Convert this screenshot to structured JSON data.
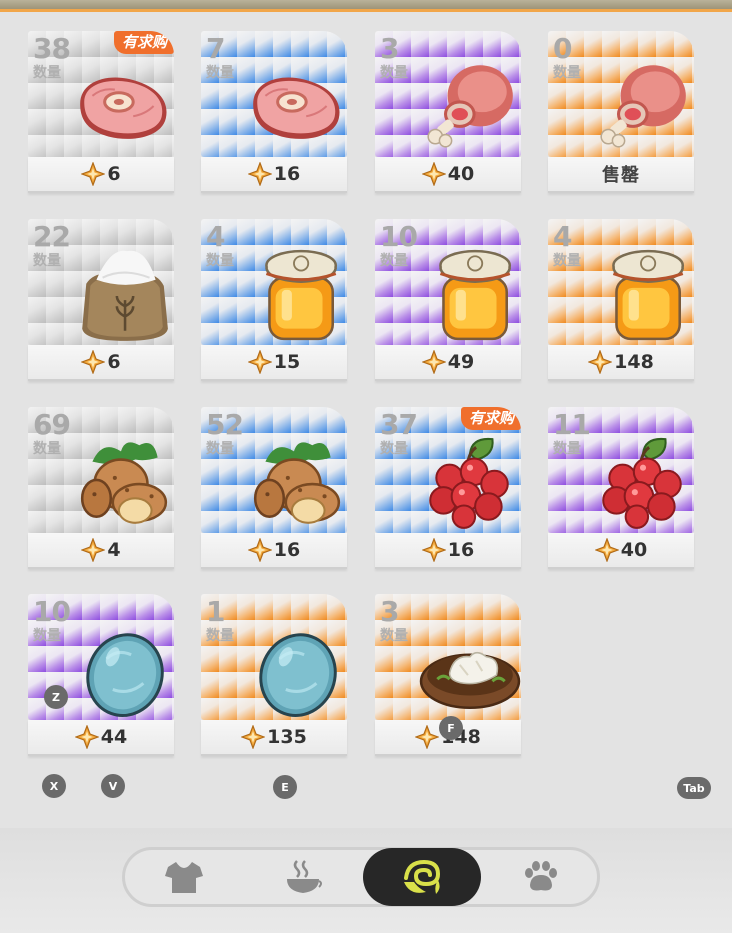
{
  "labels": {
    "quantity": "数量",
    "sold_out": "售罄",
    "wanted_badge": "有求购"
  },
  "items": [
    {
      "count": "38",
      "price": "6",
      "rarity": "grey",
      "icon": "steak-icon",
      "wanted": true,
      "sold_out": false
    },
    {
      "count": "7",
      "price": "16",
      "rarity": "blue",
      "icon": "steak-icon",
      "wanted": false,
      "sold_out": false
    },
    {
      "count": "3",
      "price": "40",
      "rarity": "purple",
      "icon": "ham-leg-icon",
      "wanted": false,
      "sold_out": false
    },
    {
      "count": "0",
      "price": "",
      "rarity": "orange",
      "icon": "ham-leg-icon",
      "wanted": false,
      "sold_out": true
    },
    {
      "count": "22",
      "price": "6",
      "rarity": "grey",
      "icon": "flour-sack-icon",
      "wanted": false,
      "sold_out": false
    },
    {
      "count": "4",
      "price": "15",
      "rarity": "blue",
      "icon": "honey-jar-icon",
      "wanted": false,
      "sold_out": false
    },
    {
      "count": "10",
      "price": "49",
      "rarity": "purple",
      "icon": "honey-jar-icon",
      "wanted": false,
      "sold_out": false
    },
    {
      "count": "4",
      "price": "148",
      "rarity": "orange",
      "icon": "honey-jar-icon",
      "wanted": false,
      "sold_out": false
    },
    {
      "count": "69",
      "price": "4",
      "rarity": "grey",
      "icon": "potato-icon",
      "wanted": false,
      "sold_out": false
    },
    {
      "count": "52",
      "price": "16",
      "rarity": "blue",
      "icon": "potato-icon",
      "wanted": false,
      "sold_out": false
    },
    {
      "count": "37",
      "price": "16",
      "rarity": "blue",
      "icon": "red-berry-icon",
      "wanted": true,
      "sold_out": false
    },
    {
      "count": "11",
      "price": "40",
      "rarity": "purple",
      "icon": "red-berry-icon",
      "wanted": false,
      "sold_out": false
    },
    {
      "count": "10",
      "price": "44",
      "rarity": "purple",
      "icon": "blue-egg-icon",
      "wanted": false,
      "sold_out": false
    },
    {
      "count": "1",
      "price": "135",
      "rarity": "orange",
      "icon": "blue-egg-icon",
      "wanted": false,
      "sold_out": false
    },
    {
      "count": "3",
      "price": "148",
      "rarity": "orange",
      "icon": "tofu-dish-icon",
      "wanted": false,
      "sold_out": false
    }
  ],
  "key_hints": {
    "z": "Z",
    "f": "F",
    "x": "X",
    "v": "V",
    "e": "E",
    "tab": "Tab"
  },
  "tabs": [
    {
      "icon": "shirt-icon",
      "active": false
    },
    {
      "icon": "food-icon",
      "active": false
    },
    {
      "icon": "ingredient-icon",
      "active": true
    },
    {
      "icon": "paw-icon",
      "active": false
    }
  ],
  "colors": {
    "grey": "#bdbdbd",
    "blue": "#3f8ae6",
    "purple": "#8e4de0",
    "orange": "#f08a1f",
    "badge": "#f06f2c",
    "active_tab": "#272727",
    "icon_inactive": "#8a8a8a",
    "icon_active": "#d9e04a"
  }
}
